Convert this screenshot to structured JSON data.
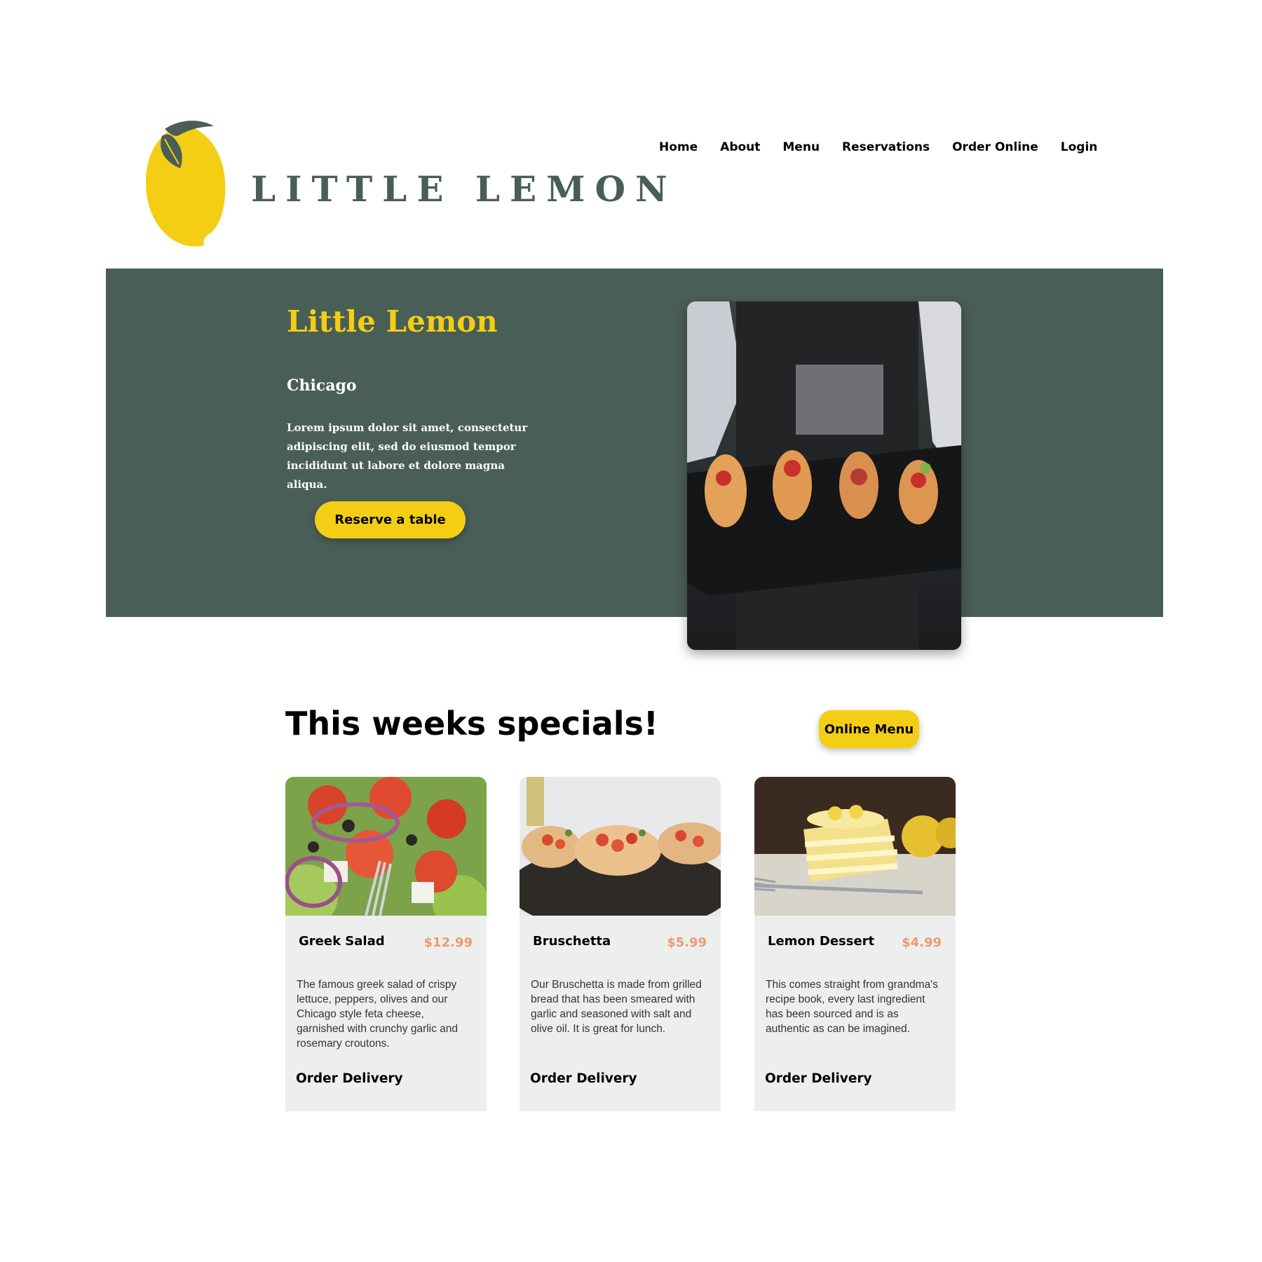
{
  "header": {
    "logo_text": "LITTLE LEMON",
    "nav": [
      "Home",
      "About",
      "Menu",
      "Reservations",
      "Order Online",
      "Login"
    ]
  },
  "hero": {
    "title": "Little Lemon",
    "city": "Chicago",
    "description": "Lorem ipsum dolor sit amet, consectetur adipiscing elit, sed do eiusmod tempor incididunt ut labore et dolore magna aliqua.",
    "cta_label": "Reserve a table"
  },
  "specials": {
    "title": "This weeks specials!",
    "menu_button": "Online Menu",
    "cards": [
      {
        "name": "Greek Salad",
        "price": "$12.99",
        "description": "The famous greek salad of crispy lettuce, peppers, olives and our Chicago style feta cheese, garnished with crunchy garlic and rosemary croutons.",
        "action": "Order Delivery"
      },
      {
        "name": "Bruschetta",
        "price": "$5.99",
        "description": "Our Bruschetta is made from grilled bread that has been smeared with garlic and seasoned with salt and olive oil. It is great for lunch.",
        "action": "Order Delivery"
      },
      {
        "name": "Lemon Dessert",
        "price": "$4.99",
        "description": "This comes straight from grandma's recipe book, every last ingredient has been sourced and is as authentic as can be imagined.",
        "action": "Order Delivery"
      }
    ]
  },
  "colors": {
    "primary_green": "#495e57",
    "primary_yellow": "#f4ce14",
    "price_salmon": "#ee9972",
    "card_bg": "#edefee"
  }
}
